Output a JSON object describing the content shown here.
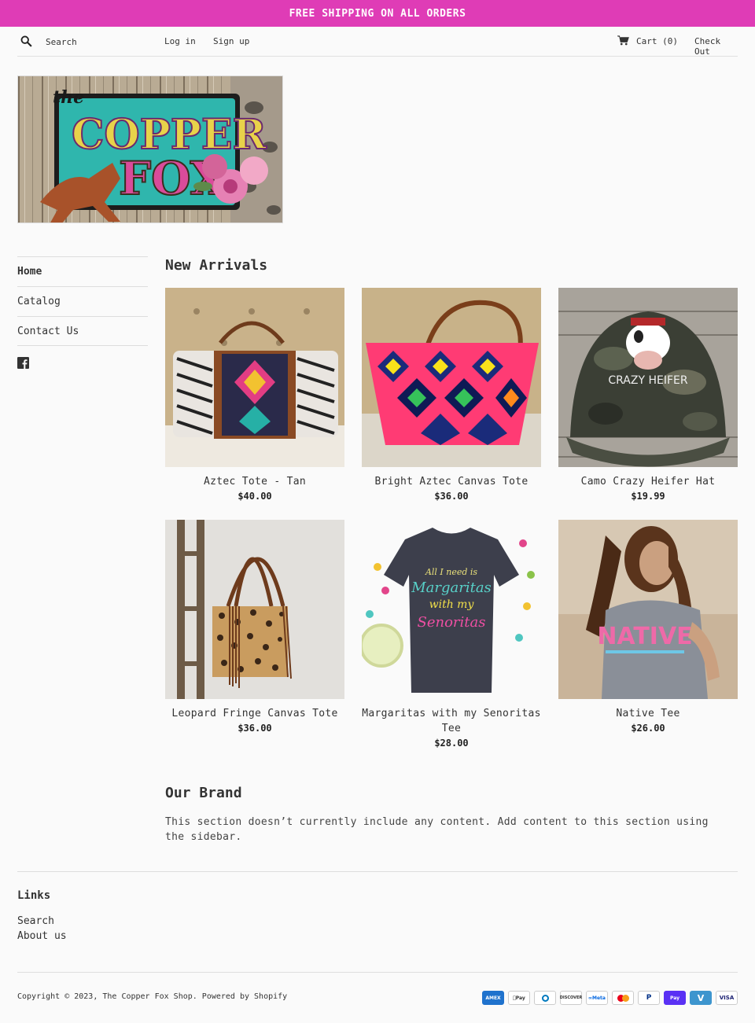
{
  "announcement": "FREE SHIPPING ON ALL ORDERS",
  "header": {
    "search_placeholder": "Search",
    "login": "Log in",
    "signup": "Sign up",
    "cart": "Cart (0)",
    "checkout": "Check Out"
  },
  "sidebar": {
    "items": [
      {
        "label": "Home"
      },
      {
        "label": "Catalog"
      },
      {
        "label": "Contact Us"
      }
    ]
  },
  "new_arrivals": {
    "title": "New Arrivals",
    "products": [
      {
        "name": "Aztec Tote - Tan",
        "price": "$40.00"
      },
      {
        "name": "Bright Aztec Canvas Tote",
        "price": "$36.00"
      },
      {
        "name": "Camo Crazy Heifer Hat",
        "price": "$19.99"
      },
      {
        "name": "Leopard Fringe Canvas Tote",
        "price": "$36.00"
      },
      {
        "name": "Margaritas with my Senoritas Tee",
        "price": "$28.00"
      },
      {
        "name": "Native Tee",
        "price": "$26.00"
      }
    ]
  },
  "brand": {
    "title": "Our Brand",
    "text": "This section doesn’t currently include any content. Add content to this section using the sidebar."
  },
  "footer": {
    "links_title": "Links",
    "links": [
      "Search",
      "About us"
    ],
    "copyright": "Copyright © 2023, The Copper Fox Shop. Powered by Shopify",
    "payments": [
      "AMEX",
      "Apple Pay",
      "Diners",
      "DISCOVER",
      "Meta",
      "Mastercard",
      "PayPal",
      "Shop Pay",
      "Venmo",
      "VISA"
    ]
  },
  "colors": {
    "announcement_bg": "#df3cb6",
    "page_bg": "#fafafa",
    "text": "#333333"
  }
}
